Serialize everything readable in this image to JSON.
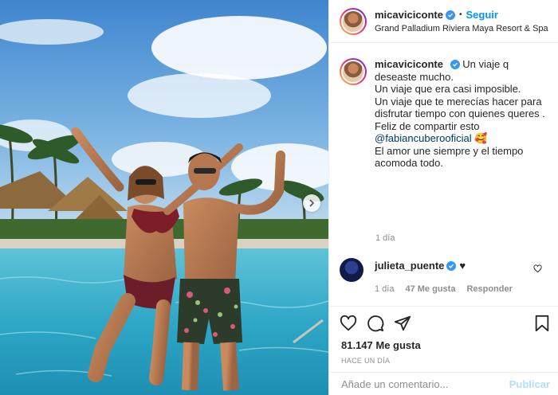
{
  "post": {
    "username": "micaviciconte",
    "follow_label": "Seguir",
    "separator": "•",
    "location": "Grand Palladium Riviera Maya Resort & Spa"
  },
  "caption": {
    "username": "micaviciconte",
    "lines": [
      "Un viaje q deseaste mucho.",
      "Un viaje que era casi imposible.",
      "Un viaje que te merecías hacer para disfrutar tiempo con quienes queres .",
      "Feliz de compartir esto",
      "@fabiancuberooficial 🥰",
      "El amor une siempre y el tiempo acomoda todo."
    ],
    "time": "1 día"
  },
  "comment": {
    "username": "julieta_puente",
    "text": "♥",
    "time": "1 día",
    "likes": "47 Me gusta",
    "reply_label": "Responder"
  },
  "stats": {
    "likes": "81.147 Me gusta",
    "posted": "HACE UN DÍA"
  },
  "comment_box": {
    "placeholder": "Añade un comentario...",
    "publish_label": "Publicar"
  },
  "icons": [
    "verified-badge-icon",
    "heart-icon",
    "comment-icon",
    "share-icon",
    "bookmark-icon",
    "chevron-right-icon"
  ],
  "colors": {
    "link": "#0095f6",
    "verified": "#3897f0",
    "muted": "#8e8e8e",
    "publish_disabled": "#b2dffc"
  }
}
